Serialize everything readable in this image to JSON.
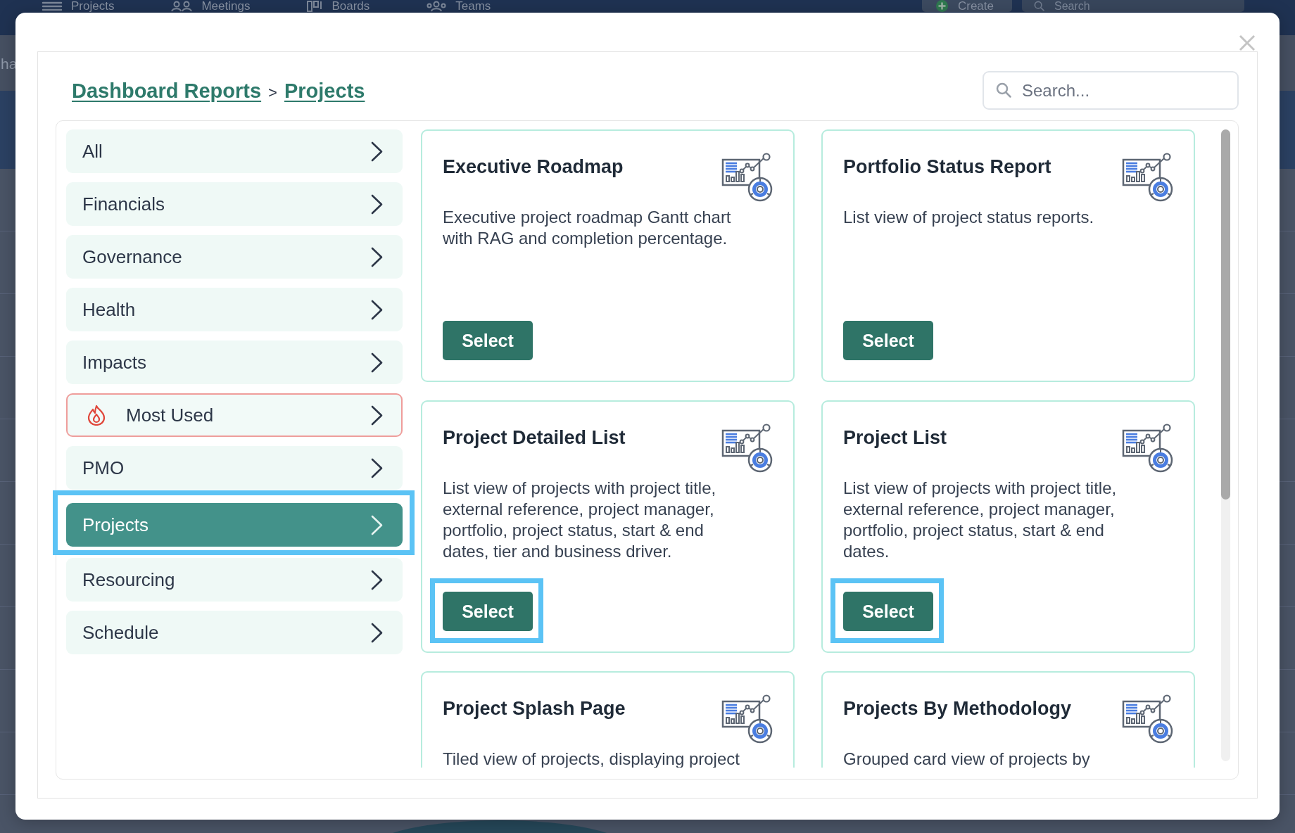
{
  "background": {
    "nav": [
      {
        "label": "Projects"
      },
      {
        "label": "Meetings"
      },
      {
        "label": "Boards"
      },
      {
        "label": "Teams"
      }
    ],
    "create_button": "Create",
    "search": {
      "placeholder": "Search"
    },
    "page_text": "ha"
  },
  "modal": {
    "breadcrumb": [
      {
        "label": "Dashboard Reports"
      },
      {
        "label": "Projects"
      }
    ],
    "breadcrumb_separator": ">",
    "search": {
      "placeholder": "Search..."
    }
  },
  "sidebar": {
    "items": [
      {
        "label": "All",
        "kind": "category",
        "selected": false,
        "highlighted": false
      },
      {
        "label": "Financials",
        "kind": "category",
        "selected": false,
        "highlighted": false
      },
      {
        "label": "Governance",
        "kind": "category",
        "selected": false,
        "highlighted": false
      },
      {
        "label": "Health",
        "kind": "category",
        "selected": false,
        "highlighted": false
      },
      {
        "label": "Impacts",
        "kind": "category",
        "selected": false,
        "highlighted": false
      },
      {
        "label": "Most Used",
        "kind": "featured",
        "selected": false,
        "highlighted": false
      },
      {
        "label": "PMO",
        "kind": "category",
        "selected": false,
        "highlighted": false
      },
      {
        "label": "Projects",
        "kind": "category",
        "selected": true,
        "highlighted": true
      },
      {
        "label": "Resourcing",
        "kind": "category",
        "selected": false,
        "highlighted": false
      },
      {
        "label": "Schedule",
        "kind": "category",
        "selected": false,
        "highlighted": false
      }
    ]
  },
  "cards": [
    {
      "title": "Executive Roadmap",
      "description": "Executive project roadmap Gantt chart with RAG and completion percentage.",
      "button": "Select",
      "highlighted": false
    },
    {
      "title": "Portfolio Status Report",
      "description": "List view of project status reports.",
      "button": "Select",
      "highlighted": false
    },
    {
      "title": "Project Detailed List",
      "description": "List view of projects with project title, external reference, project manager, portfolio, project status, start & end dates, tier and business driver.",
      "button": "Select",
      "highlighted": true
    },
    {
      "title": "Project List",
      "description": "List view of projects with project title, external reference, project manager, portfolio, project status, start & end dates.",
      "button": "Select",
      "highlighted": true
    },
    {
      "title": "Project Splash Page",
      "description": "Tiled view of projects, displaying project",
      "highlighted": false
    },
    {
      "title": "Projects By Methodology",
      "description": "Grouped card view of projects by",
      "highlighted": false
    }
  ]
}
